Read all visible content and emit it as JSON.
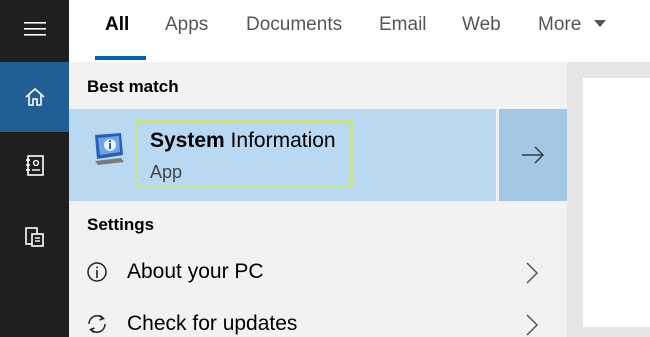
{
  "tabs": [
    {
      "label": "All",
      "active": true
    },
    {
      "label": "Apps"
    },
    {
      "label": "Documents"
    },
    {
      "label": "Email"
    },
    {
      "label": "Web"
    },
    {
      "label": "More"
    }
  ],
  "rail": {
    "icons": [
      "hamburger-icon",
      "home-icon",
      "notebook-icon",
      "devices-icon"
    ],
    "active": "home-icon"
  },
  "best_match": {
    "section_label": "Best match",
    "name_bold": "System",
    "name_rest": " Information",
    "type": "App",
    "icon": "system-information-icon"
  },
  "settings": {
    "section_label": "Settings",
    "items": [
      {
        "label": "About your PC",
        "icon": "info-icon"
      },
      {
        "label": "Check for updates",
        "icon": "refresh-icon"
      }
    ]
  },
  "colors": {
    "accent": "#0063b1",
    "rail_bg": "#1f1f1f",
    "rail_active": "#1f5f96",
    "selected_row": "#b9d9f2",
    "highlight_border": "#c6e38a"
  }
}
